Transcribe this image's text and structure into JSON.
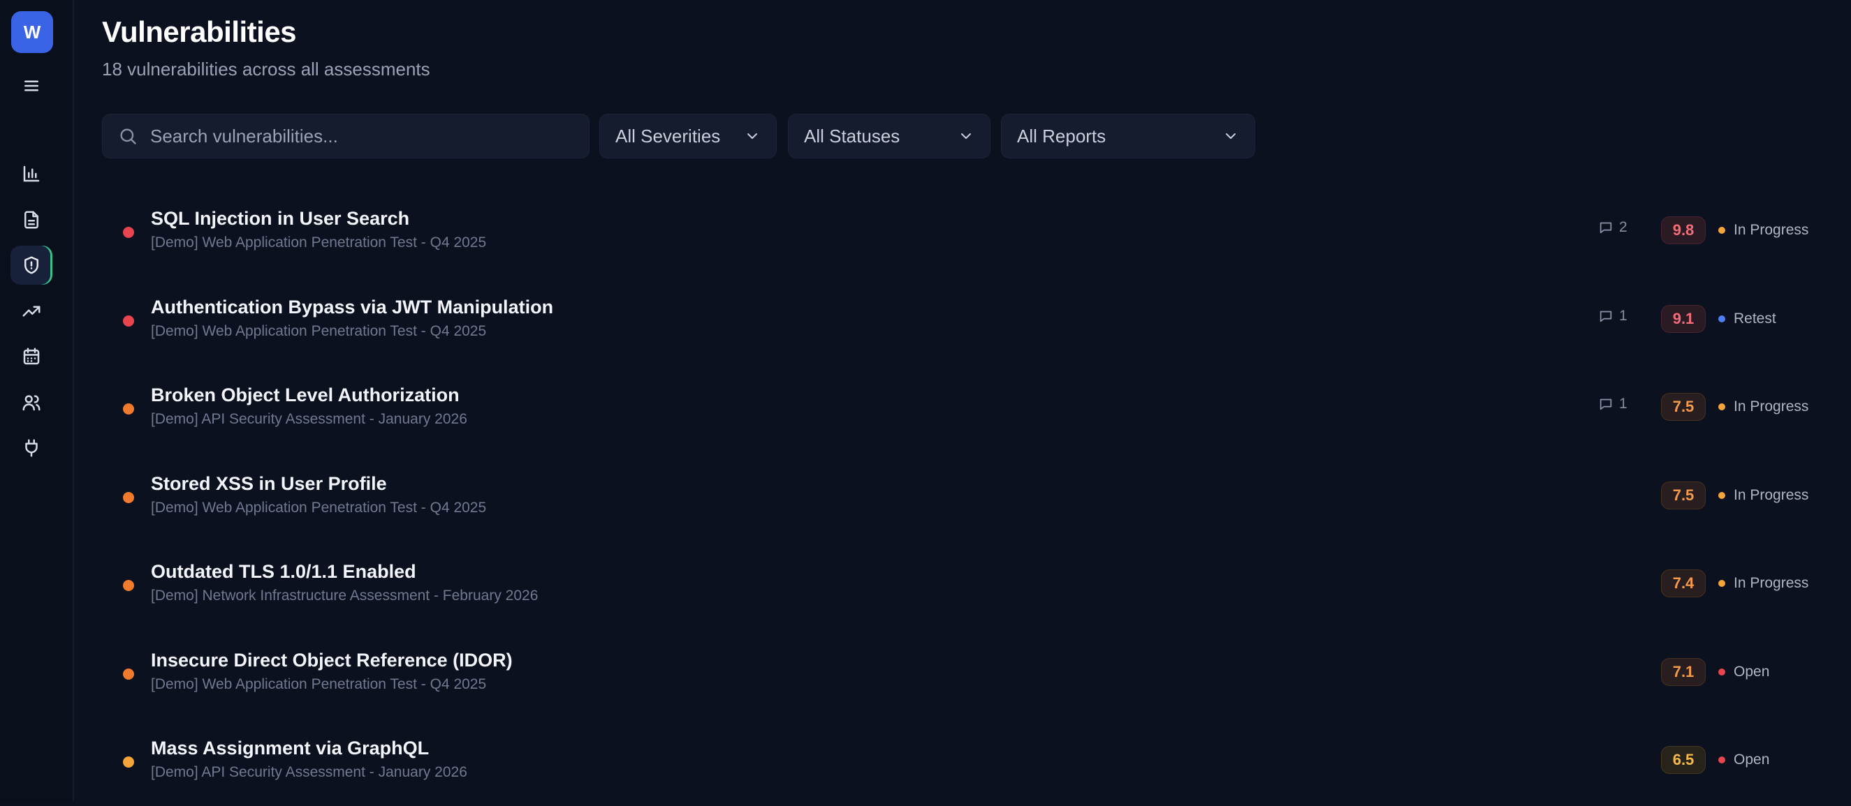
{
  "app": {
    "logo_letter": "W",
    "accent": "#3b63e6"
  },
  "sidebar": {
    "items": [
      {
        "name": "menu",
        "icon": "menu-icon"
      },
      {
        "name": "dashboard",
        "icon": "bar-chart-icon"
      },
      {
        "name": "reports",
        "icon": "document-icon"
      },
      {
        "name": "vulnerabilities",
        "icon": "shield-alert-icon",
        "active": true
      },
      {
        "name": "trends",
        "icon": "trending-up-icon"
      },
      {
        "name": "calendar",
        "icon": "calendar-icon"
      },
      {
        "name": "users",
        "icon": "users-icon"
      },
      {
        "name": "integrations",
        "icon": "plug-icon"
      }
    ]
  },
  "header": {
    "title": "Vulnerabilities",
    "subtitle": "18 vulnerabilities across all assessments"
  },
  "filters": {
    "search_placeholder": "Search vulnerabilities...",
    "severity": "All Severities",
    "status": "All Statuses",
    "report": "All Reports"
  },
  "colors": {
    "critical": "#e8454e",
    "high": "#f07b2f",
    "medium": "#f5a53a",
    "status_in_progress": "#f5a53a",
    "status_retest": "#4f7ef5",
    "status_open": "#e8454e"
  },
  "vulnerabilities": [
    {
      "title": "SQL Injection in User Search",
      "report": "[Demo] Web Application Penetration Test - Q4 2025",
      "comments": "2",
      "score": "9.8",
      "severity": "critical",
      "status": "In Progress",
      "status_key": "in_progress"
    },
    {
      "title": "Authentication Bypass via JWT Manipulation",
      "report": "[Demo] Web Application Penetration Test - Q4 2025",
      "comments": "1",
      "score": "9.1",
      "severity": "critical",
      "status": "Retest",
      "status_key": "retest"
    },
    {
      "title": "Broken Object Level Authorization",
      "report": "[Demo] API Security Assessment - January 2026",
      "comments": "1",
      "score": "7.5",
      "severity": "high",
      "status": "In Progress",
      "status_key": "in_progress"
    },
    {
      "title": "Stored XSS in User Profile",
      "report": "[Demo] Web Application Penetration Test - Q4 2025",
      "comments": "",
      "score": "7.5",
      "severity": "high",
      "status": "In Progress",
      "status_key": "in_progress"
    },
    {
      "title": "Outdated TLS 1.0/1.1 Enabled",
      "report": "[Demo] Network Infrastructure Assessment - February 2026",
      "comments": "",
      "score": "7.4",
      "severity": "high",
      "status": "In Progress",
      "status_key": "in_progress"
    },
    {
      "title": "Insecure Direct Object Reference (IDOR)",
      "report": "[Demo] Web Application Penetration Test - Q4 2025",
      "comments": "",
      "score": "7.1",
      "severity": "high",
      "status": "Open",
      "status_key": "open"
    },
    {
      "title": "Mass Assignment via GraphQL",
      "report": "[Demo] API Security Assessment - January 2026",
      "comments": "",
      "score": "6.5",
      "severity": "medium",
      "status": "Open",
      "status_key": "open"
    }
  ]
}
